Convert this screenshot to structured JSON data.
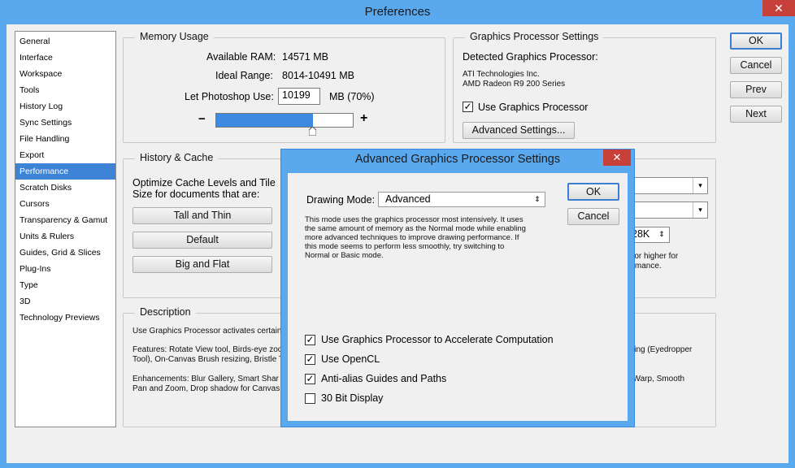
{
  "window": {
    "title": "Preferences",
    "close_glyph": "✕"
  },
  "nav": {
    "items": [
      "General",
      "Interface",
      "Workspace",
      "Tools",
      "History Log",
      "Sync Settings",
      "File Handling",
      "Export",
      "Performance",
      "Scratch Disks",
      "Cursors",
      "Transparency & Gamut",
      "Units & Rulers",
      "Guides, Grid & Slices",
      "Plug-Ins",
      "Type",
      "3D",
      "Technology Previews"
    ],
    "selected": "Performance"
  },
  "buttons": {
    "ok": "OK",
    "cancel": "Cancel",
    "prev": "Prev",
    "next": "Next"
  },
  "memory": {
    "title": "Memory Usage",
    "available_label": "Available RAM:",
    "available_value": "14571 MB",
    "ideal_label": "Ideal Range:",
    "ideal_value": "8014-10491 MB",
    "let_label": "Let Photoshop Use:",
    "let_value": "10199",
    "let_unit": "MB (70%)",
    "minus": "−",
    "plus": "+",
    "slider_fraction": 0.7
  },
  "gpu": {
    "title": "Graphics Processor Settings",
    "detected_label": "Detected Graphics Processor:",
    "vendor": "ATI Technologies Inc.",
    "model": "AMD Radeon R9 200 Series",
    "use_gpu_label": "Use Graphics Processor",
    "use_gpu_checked": true,
    "advanced_button": "Advanced Settings..."
  },
  "history": {
    "title": "History & Cache",
    "desc_line1": "Optimize Cache Levels and Tile",
    "desc_line2": "Size for documents that are:",
    "tall_thin": "Tall and Thin",
    "default": "Default",
    "big_flat": "Big and Flat",
    "tile_value": "28K",
    "note_line1": "2 or higher for",
    "note_line2": "ormance."
  },
  "description": {
    "title": "Description",
    "line1": "Use Graphics Processor activates certain",
    "features_a": "Features: Rotate View tool, Birds-eye zoo",
    "features_b": "Tool), On-Canvas Brush resizing, Bristle T",
    "features_right": "Ring (Eyedropper",
    "enh_a": "Enhancements: Blur Gallery, Smart Shar",
    "enh_b": "Pan and Zoom, Drop shadow for Canvas",
    "enh_right": "t Warp, Smooth"
  },
  "modal": {
    "title": "Advanced Graphics Processor Settings",
    "close_glyph": "✕",
    "drawing_mode_label": "Drawing Mode:",
    "drawing_mode_value": "Advanced",
    "ok": "OK",
    "cancel": "Cancel",
    "help_lines": [
      "This mode uses the graphics processor most intensively.  It uses",
      "the same amount of memory as the Normal mode while enabling",
      "more advanced techniques to improve drawing performance.  If",
      "this mode seems to perform less smoothly, try switching to",
      "Normal or Basic mode."
    ],
    "options": [
      {
        "label": "Use Graphics Processor to Accelerate Computation",
        "checked": true
      },
      {
        "label": "Use OpenCL",
        "checked": true
      },
      {
        "label": "Anti-alias Guides and Paths",
        "checked": true
      },
      {
        "label": "30 Bit Display",
        "checked": false
      }
    ]
  },
  "check_glyph": "✓",
  "dropdown_arrow": "▾",
  "updown_arrow": "⇕"
}
